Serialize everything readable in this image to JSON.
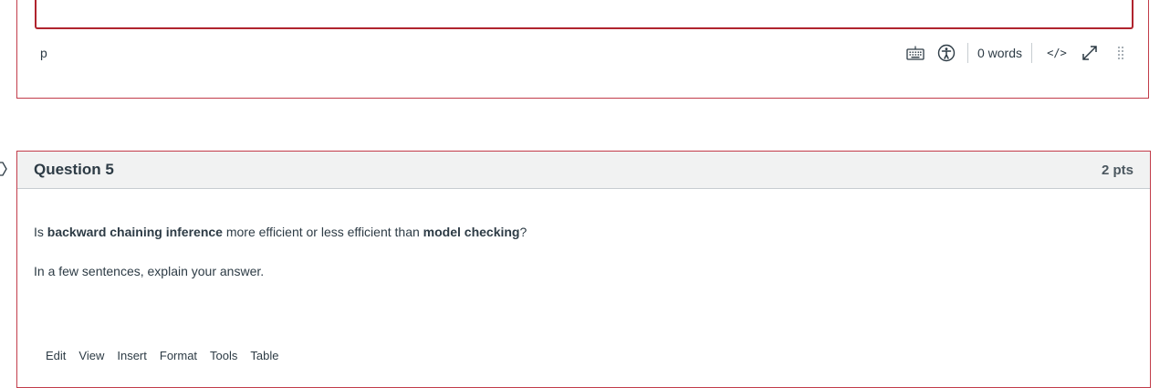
{
  "previous_editor": {
    "element_path": "p",
    "word_count": "0 words",
    "code_toggle_label": "</>",
    "icons": [
      "keyboard-icon",
      "accessibility-icon",
      "code-icon",
      "fullscreen-icon",
      "resize-handle-icon"
    ]
  },
  "question": {
    "title": "Question 5",
    "points": "2 pts",
    "prompt": {
      "part1": "Is ",
      "bold1": "backward chaining inference",
      "part2": " more efficient or less efficient than ",
      "bold2": "model checking",
      "part3": "?"
    },
    "instruction": "In a few sentences, explain your answer."
  },
  "editor_menu": {
    "items": [
      "Edit",
      "View",
      "Insert",
      "Format",
      "Tools",
      "Table"
    ]
  },
  "colors": {
    "card_border": "#c23c4a",
    "header_bg": "#f1f2f2",
    "text": "#2d3b45"
  }
}
